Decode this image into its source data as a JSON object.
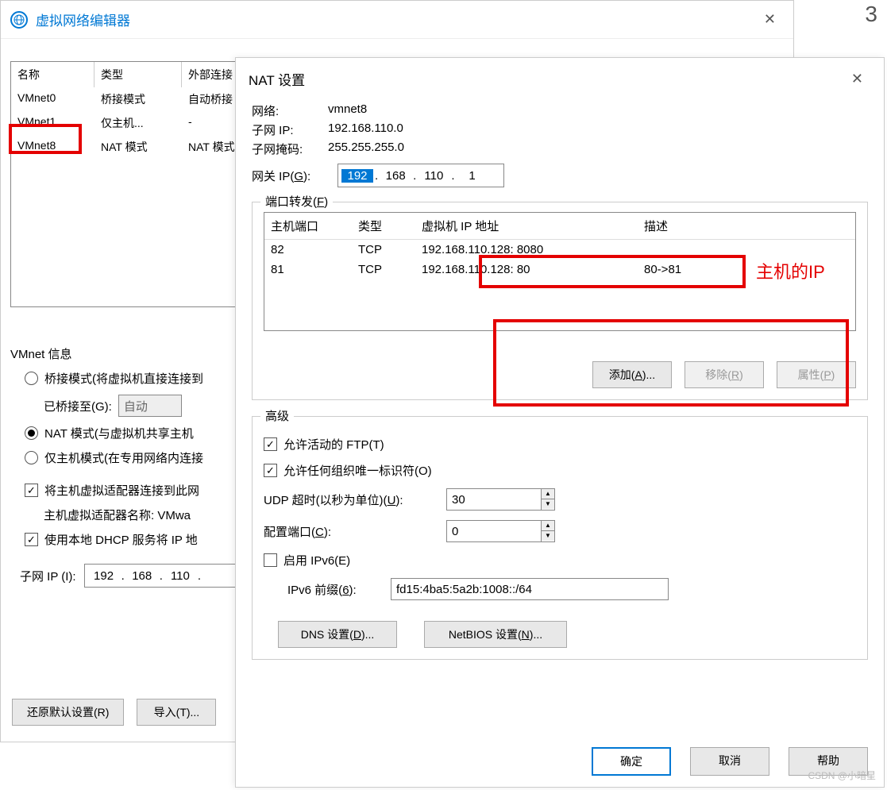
{
  "page_number": "3",
  "watermark": "CSDN @小暗星",
  "parent": {
    "title": "虚拟网络编辑器",
    "columns": {
      "name": "名称",
      "type": "类型",
      "ext": "外部连接"
    },
    "rows": [
      {
        "name": "VMnet0",
        "type": "桥接模式",
        "ext": "自动桥接"
      },
      {
        "name": "VMnet1",
        "type": "仅主机...",
        "ext": "-"
      },
      {
        "name": "VMnet8",
        "type": "NAT 模式",
        "ext": "NAT 模式"
      }
    ],
    "info_label": "VMnet 信息",
    "radio_bridge": "桥接模式(将虚拟机直接连接到",
    "bridge_to_label": "已桥接至(G):",
    "bridge_to_value": "自动",
    "radio_nat": "NAT 模式(与虚拟机共享主机",
    "radio_hostonly": "仅主机模式(在专用网络内连接",
    "chk_connect": "将主机虚拟适配器连接到此网",
    "adapter_label": "主机虚拟适配器名称: VMwa",
    "chk_dhcp": "使用本地 DHCP 服务将 IP 地",
    "subnet_label": "子网 IP (I):",
    "subnet_ip": [
      "192",
      "168",
      "110",
      ""
    ],
    "btn_restore": "还原默认设置(R)",
    "btn_import": "导入(T)..."
  },
  "nat": {
    "title": "NAT 设置",
    "network_label": "网络:",
    "network_value": "vmnet8",
    "subnet_ip_label": "子网 IP:",
    "subnet_ip_value": "192.168.110.0",
    "mask_label": "子网掩码:",
    "mask_value": "255.255.255.0",
    "gateway_label": "网关 IP(G):",
    "gateway_ip": [
      "192",
      "168",
      "110",
      "1"
    ],
    "annotation": "主机的IP",
    "port_forward_label": "端口转发(F)",
    "port_cols": {
      "host": "主机端口",
      "type": "类型",
      "addr": "虚拟机 IP 地址",
      "desc": "描述"
    },
    "port_rows": [
      {
        "host": "82",
        "type": "TCP",
        "addr": "192.168.110.128: 8080",
        "desc": ""
      },
      {
        "host": "81",
        "type": "TCP",
        "addr": "192.168.110.128: 80",
        "desc": "80->81"
      }
    ],
    "btn_add": "添加(A)...",
    "btn_remove": "移除(R)",
    "btn_prop": "属性(P)",
    "adv_label": "高级",
    "chk_ftp": "允许活动的 FTP(T)",
    "chk_org": "允许任何组织唯一标识符(O)",
    "udp_label": "UDP 超时(以秒为单位)(U):",
    "udp_value": "30",
    "cfg_port_label": "配置端口(C):",
    "cfg_port_value": "0",
    "chk_ipv6": "启用 IPv6(E)",
    "ipv6_prefix_label": "IPv6 前缀(6):",
    "ipv6_prefix_value": "fd15:4ba5:5a2b:1008::/64",
    "btn_dns": "DNS 设置(D)...",
    "btn_netbios": "NetBIOS 设置(N)...",
    "btn_ok": "确定",
    "btn_cancel": "取消",
    "btn_help": "帮助"
  }
}
